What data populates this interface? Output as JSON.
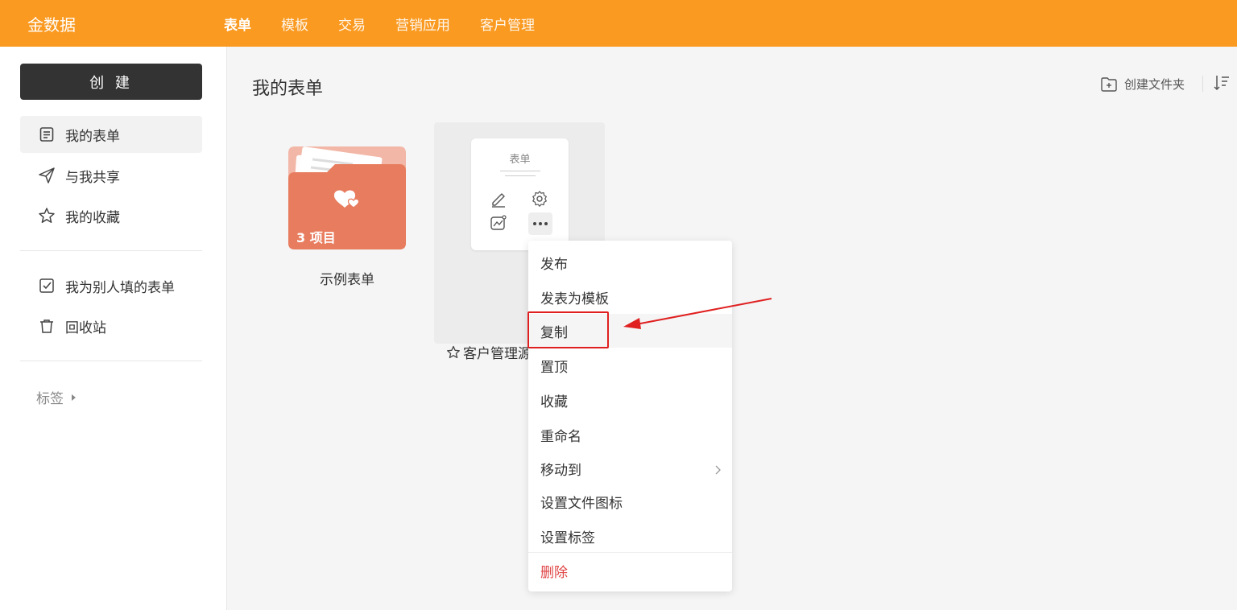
{
  "header": {
    "brand": "金数据",
    "nav": [
      {
        "label": "表单",
        "active": true
      },
      {
        "label": "模板",
        "active": false
      },
      {
        "label": "交易",
        "active": false
      },
      {
        "label": "营销应用",
        "active": false
      },
      {
        "label": "客户管理",
        "active": false
      }
    ],
    "accent_color": "#fa9a21"
  },
  "sidebar": {
    "create_label": "创 建",
    "items": [
      {
        "label": "我的表单",
        "icon": "form-doc-icon",
        "active": true
      },
      {
        "label": "与我共享",
        "icon": "paper-plane-icon",
        "active": false
      },
      {
        "label": "我的收藏",
        "icon": "star-icon",
        "active": false
      },
      {
        "label": "我为别人填的表单",
        "icon": "checkbox-icon",
        "active": false
      },
      {
        "label": "回收站",
        "icon": "trash-icon",
        "active": false
      }
    ],
    "tags_label": "标签"
  },
  "main": {
    "title": "我的表单",
    "create_folder_label": "创建文件夹",
    "folder": {
      "count_label": "3 项目",
      "name": "示例表单",
      "color": "#e87c5e"
    },
    "form": {
      "thumb_title": "表单",
      "name": "客户管理源"
    }
  },
  "context_menu": {
    "items": [
      {
        "label": "发布"
      },
      {
        "label": "发表为模板"
      },
      {
        "label": "复制"
      },
      {
        "label": "置顶"
      },
      {
        "label": "收藏"
      },
      {
        "label": "重命名"
      },
      {
        "label": "移动到"
      },
      {
        "label": "设置文件图标"
      },
      {
        "label": "设置标签"
      },
      {
        "label": "删除"
      }
    ]
  }
}
